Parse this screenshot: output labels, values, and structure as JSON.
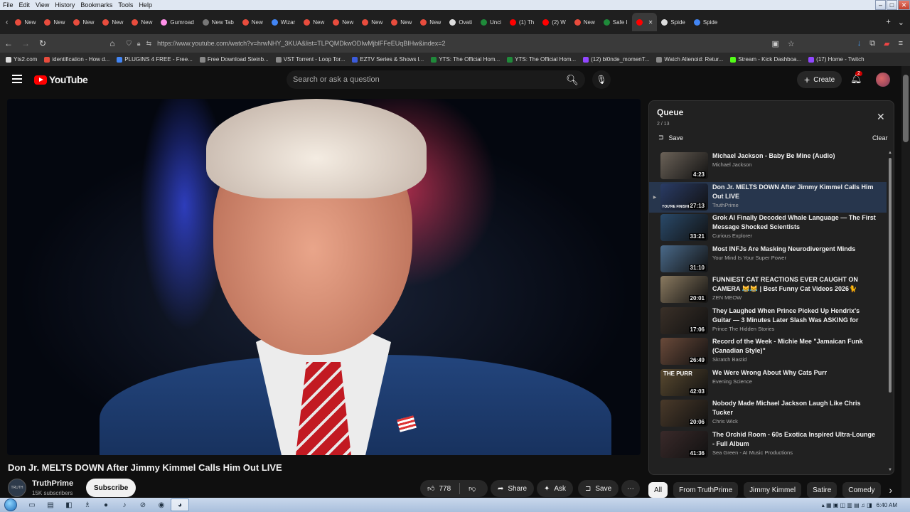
{
  "menubar": {
    "items": [
      "File",
      "Edit",
      "View",
      "History",
      "Bookmarks",
      "Tools",
      "Help"
    ]
  },
  "tabs": [
    {
      "label": "New",
      "color": "#e84c3d"
    },
    {
      "label": "New",
      "color": "#e84c3d"
    },
    {
      "label": "New",
      "color": "#e84c3d"
    },
    {
      "label": "New",
      "color": "#e84c3d"
    },
    {
      "label": "New",
      "color": "#e84c3d"
    },
    {
      "label": "Gumroad",
      "color": "#ff90e8"
    },
    {
      "label": "New Tab",
      "color": "#777777"
    },
    {
      "label": "New",
      "color": "#e84c3d"
    },
    {
      "label": "Wizar",
      "color": "#4285f4"
    },
    {
      "label": "New",
      "color": "#e84c3d"
    },
    {
      "label": "New",
      "color": "#e84c3d"
    },
    {
      "label": "New",
      "color": "#e84c3d"
    },
    {
      "label": "New",
      "color": "#e84c3d"
    },
    {
      "label": "New",
      "color": "#e84c3d"
    },
    {
      "label": "Ovati",
      "color": "#dddddd"
    },
    {
      "label": "Unci",
      "color": "#1f8a3a"
    },
    {
      "label": "(1) Th",
      "color": "#ff0000"
    },
    {
      "label": "(2) W",
      "color": "#ff0000"
    },
    {
      "label": "New",
      "color": "#e84c3d"
    },
    {
      "label": "Safe I",
      "color": "#1f8a3a"
    },
    {
      "label": "",
      "color": "#ff0000"
    },
    {
      "label": "Spide",
      "color": "#dddddd"
    },
    {
      "label": "Spide",
      "color": "#4285f4"
    }
  ],
  "address": {
    "url": "https://www.youtube.com/watch?v=hrwNHY_3KUA&list=TLPQMDkwODIwMjblFFeEUqBIHw&index=2"
  },
  "bookmarks": [
    {
      "label": "Yts2.com",
      "color": "#dddddd"
    },
    {
      "label": "identification - How d...",
      "color": "#e84c3d"
    },
    {
      "label": "PLUGINS 4 FREE - Free...",
      "color": "#4285f4"
    },
    {
      "label": "Free Download Steinb...",
      "color": "#888888"
    },
    {
      "label": "VST Torrent - Loop Tor...",
      "color": "#888888"
    },
    {
      "label": "EZTV Series & Shows l...",
      "color": "#3b5bdb"
    },
    {
      "label": "YTS: The Official Hom...",
      "color": "#1f8a3a"
    },
    {
      "label": "YTS: The Official Hom...",
      "color": "#1f8a3a"
    },
    {
      "label": "(12) bl0nde_momenT...",
      "color": "#9147ff"
    },
    {
      "label": "Watch Alienoid: Retur...",
      "color": "#888888"
    },
    {
      "label": "Stream - Kick Dashboa...",
      "color": "#53fc18"
    },
    {
      "label": "(17) Home - Twitch",
      "color": "#9147ff"
    }
  ],
  "youtube": {
    "logo_text": "YouTube",
    "search_placeholder": "Search or ask a question",
    "create_label": "Create",
    "notif_count": "2"
  },
  "video": {
    "title": "Don Jr. MELTS DOWN After Jimmy Kimmel Calls Him Out LIVE",
    "channel": "TruthPrime",
    "subs": "15K subscribers",
    "avatar_text": "TRUTH",
    "subscribe": "Subscribe",
    "likes": "778",
    "share": "Share",
    "ask": "Ask",
    "save": "Save"
  },
  "queue": {
    "title": "Queue",
    "count": "2 / 13",
    "save": "Save",
    "clear": "Clear",
    "items": [
      {
        "title": "Michael Jackson - Baby Be Mine (Audio)",
        "channel": "Michael Jackson",
        "duration": "4:23",
        "thumb": "#6b6258",
        "idx": ""
      },
      {
        "title": "Don Jr. MELTS DOWN After Jimmy Kimmel Calls Him Out LIVE",
        "channel": "TruthPrime",
        "duration": "27:13",
        "thumb": "#2a3c66",
        "idx": "▶"
      },
      {
        "title": "Grok AI Finally Decoded Whale Language — The First Message Shocked Scientists",
        "channel": "Curious Explorer",
        "duration": "33:21",
        "thumb": "#2a4a6a",
        "idx": ""
      },
      {
        "title": "Most INFJs Are Masking Neurodivergent Minds",
        "channel": "Your Mind Is Your Super Power",
        "duration": "31:10",
        "thumb": "#4a6a8a",
        "idx": ""
      },
      {
        "title": "FUNNIEST CAT REACTIONS EVER CAUGHT ON CAMERA 😹😹 | Best Funny Cat Videos 2026🐈",
        "channel": "ZEN MEOW",
        "duration": "20:01",
        "thumb": "#8a7a60",
        "idx": ""
      },
      {
        "title": "They Laughed When Prince Picked Up Hendrix's Guitar — 3 Minutes Later Slash Was ASKING for",
        "channel": "Prince The Hidden Stories",
        "duration": "17:06",
        "thumb": "#3a3028",
        "idx": ""
      },
      {
        "title": "Record of the Week - Michie Mee \"Jamaican Funk (Canadian Style)\"",
        "channel": "Skratch Bastid",
        "duration": "26:49",
        "thumb": "#6a4a3a",
        "idx": ""
      },
      {
        "title": "We Were Wrong About Why Cats Purr",
        "channel": "Evening Science",
        "duration": "42:03",
        "thumb": "#5a4a30",
        "idx": ""
      },
      {
        "title": "Nobody Made Michael Jackson Laugh Like Chris Tucker",
        "channel": "Chris Wick",
        "duration": "20:06",
        "thumb": "#4a3a2a",
        "idx": ""
      },
      {
        "title": "The Orchid Room - 60s Exotica Inspired Ultra-Lounge - Full Album",
        "channel": "Sea Green - AI Music Productions",
        "duration": "41:36",
        "thumb": "#3a2a2a",
        "idx": ""
      }
    ],
    "thumb_captions": {
      "purr": "THE PURR",
      "finished": "YOU'RE FINISHED"
    }
  },
  "chips": [
    "All",
    "From TruthPrime",
    "Jimmy Kimmel",
    "Satire",
    "Comedy"
  ],
  "taskbar": {
    "clock": "6:40 AM"
  },
  "colors": {
    "accent": "#ff0000",
    "bg": "#0f0f0f",
    "current_row": "#27364d"
  }
}
